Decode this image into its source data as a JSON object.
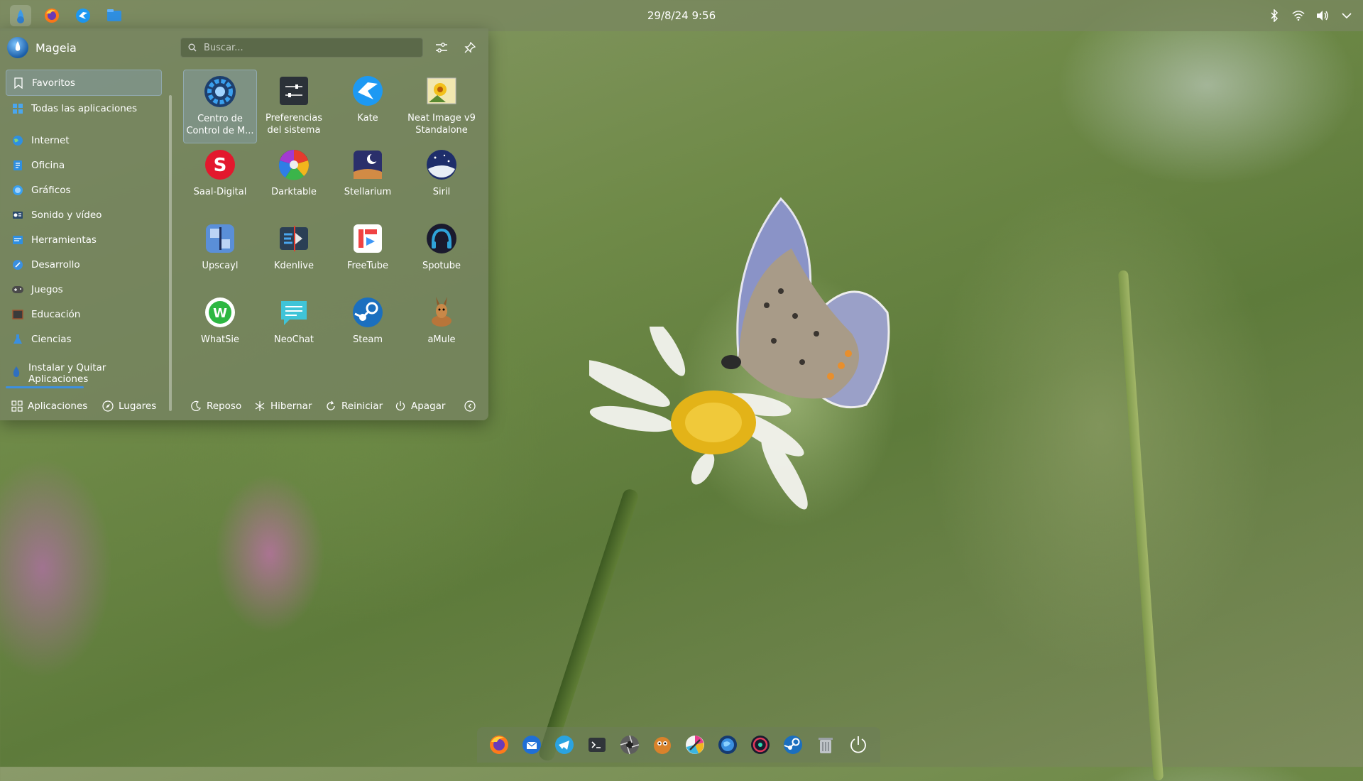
{
  "panel": {
    "clock": "29/8/24  9:56",
    "launchers": [
      "kickoff-icon",
      "firefox-icon",
      "kate-icon",
      "files-icon"
    ],
    "tray": [
      "bluetooth-icon",
      "wifi-icon",
      "volume-icon",
      "chevron-down-icon"
    ]
  },
  "menu": {
    "user_name": "Mageia",
    "search_placeholder": "Buscar...",
    "categories": [
      {
        "label": "Favoritos",
        "icon": "bookmark-icon",
        "selected": true
      },
      {
        "label": "Todas las aplicaciones",
        "icon": "grid-icon"
      },
      {
        "label": "Internet",
        "icon": "globe-icon"
      },
      {
        "label": "Oficina",
        "icon": "office-icon"
      },
      {
        "label": "Gráficos",
        "icon": "graphics-icon"
      },
      {
        "label": "Sonido y vídeo",
        "icon": "multimedia-icon"
      },
      {
        "label": "Herramientas",
        "icon": "tools-icon"
      },
      {
        "label": "Desarrollo",
        "icon": "development-icon"
      },
      {
        "label": "Juegos",
        "icon": "gamepad-icon"
      },
      {
        "label": "Educación",
        "icon": "education-icon"
      },
      {
        "label": "Ciencias",
        "icon": "science-icon"
      }
    ],
    "install_label": "Instalar y Quitar Aplicaciones",
    "apps": [
      {
        "label": "Centro de Control de M...",
        "icon": "control-center-icon"
      },
      {
        "label": "Preferencias del sistema",
        "icon": "system-settings-icon"
      },
      {
        "label": "Kate",
        "icon": "kate-icon"
      },
      {
        "label": "Neat Image v9 Standalone",
        "icon": "neat-image-icon"
      },
      {
        "label": "Saal-Digital",
        "icon": "saal-digital-icon"
      },
      {
        "label": "Darktable",
        "icon": "darktable-icon"
      },
      {
        "label": "Stellarium",
        "icon": "stellarium-icon"
      },
      {
        "label": "Siril",
        "icon": "siril-icon"
      },
      {
        "label": "Upscayl",
        "icon": "upscayl-icon"
      },
      {
        "label": "Kdenlive",
        "icon": "kdenlive-icon"
      },
      {
        "label": "FreeTube",
        "icon": "freetube-icon"
      },
      {
        "label": "Spotube",
        "icon": "spotube-icon"
      },
      {
        "label": "WhatSie",
        "icon": "whatsie-icon"
      },
      {
        "label": "NeoChat",
        "icon": "neochat-icon"
      },
      {
        "label": "Steam",
        "icon": "steam-icon"
      },
      {
        "label": "aMule",
        "icon": "amule-icon"
      }
    ],
    "footer": {
      "apps_label": "Aplicaciones",
      "places_label": "Lugares",
      "sleep_label": "Reposo",
      "hibernate_label": "Hibernar",
      "restart_label": "Reiniciar",
      "shutdown_label": "Apagar"
    }
  },
  "dock": [
    "firefox-icon",
    "thunderbird-icon",
    "telegram-icon",
    "terminal-icon",
    "aperture-icon",
    "gimp-icon",
    "kolourpaint-icon",
    "globe-app-icon",
    "music-player-icon",
    "steam-icon",
    "trash-icon",
    "power-icon"
  ],
  "colors": {
    "accent": "#3d8fe0",
    "panel": "#78875f",
    "selection": "#8caac8"
  }
}
